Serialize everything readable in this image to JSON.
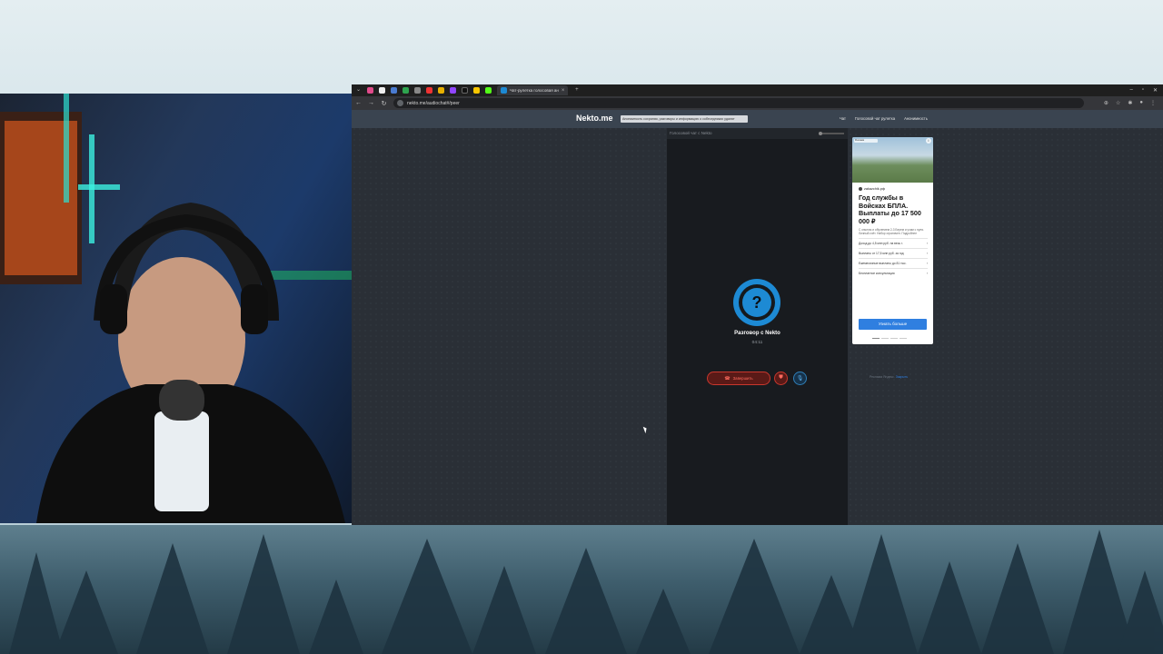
{
  "browser": {
    "tab_title": "Чат-рулетка голосовая ан",
    "url": "nekto.me/audiochat#/peer"
  },
  "site": {
    "logo": "Nekto.me",
    "notice": "Анонимность сохраняя, разговоры и информацию о собеседниках удалят",
    "nav": [
      "Чат",
      "Голосовой чат рулетка",
      "Анонимность"
    ]
  },
  "chat": {
    "header": "Голосовой чат с Nekto",
    "avatar_glyph": "?",
    "conversation_title": "Разговор с Nekto",
    "timer": "04:11",
    "hangup_label": "Завершить"
  },
  "ad": {
    "badge": "Реклама",
    "domain": "zakazchik.рф",
    "headline": "Год службы в Войсках БПЛА. Выплаты до 17 500 000 ₽",
    "body": "С опытом и обучением 2-3 Берем и учим с нуля. Личный счёт. Набор ограничен. Подробнее",
    "items": [
      "Доход до 4,5 млн руб. на весь г.",
      "Выплаты от 17,5 млн руб. за год",
      "Ежемесячные выплаты до 81 тыс.",
      "Бесплатное консультация"
    ],
    "cta": "Узнать больше",
    "footer_prefix": "Реклама Яндекс.",
    "footer_link": "Закрыть"
  },
  "colors": {
    "accent": "#1d8ad4",
    "danger": "#c8372d",
    "ad_button": "#2f7fe0"
  }
}
